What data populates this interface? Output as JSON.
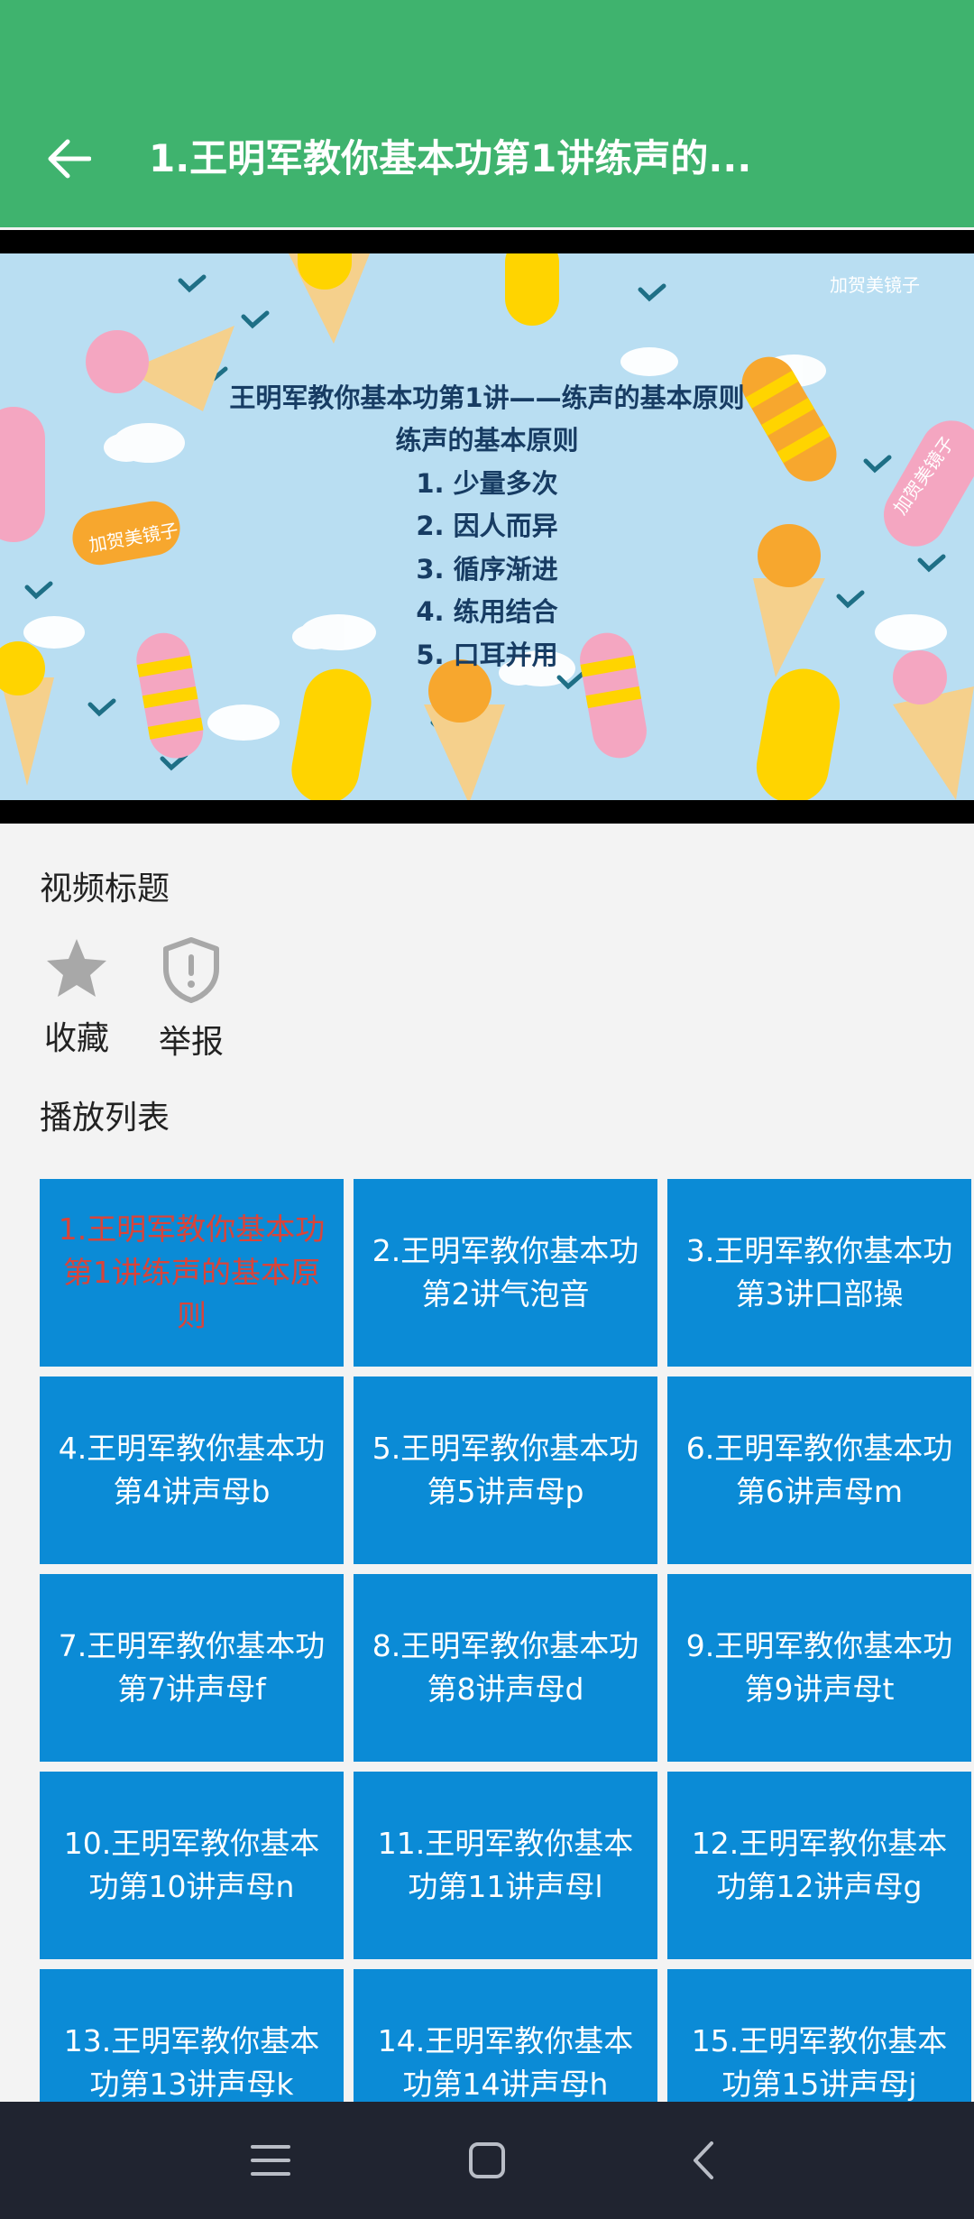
{
  "header": {
    "title": "1.王明军教你基本功第1讲练声的...",
    "back_icon": "arrow-left-icon"
  },
  "video": {
    "watermark": "加贺美镜子",
    "slide_title": "王明军教你基本功第1讲——练声的基本原则",
    "slide_subtitle": "练声的基本原则",
    "slide_points": [
      "1. 少量多次",
      "2. 因人而异",
      "3. 循序渐进",
      "4. 练用结合",
      "5. 口耳并用"
    ],
    "sticker_left": "加贺美镜子",
    "sticker_right": "加贺美镜子"
  },
  "details": {
    "video_title_label": "视频标题",
    "favorite_label": "收藏",
    "report_label": "举报",
    "playlist_label": "播放列表"
  },
  "playlist": [
    {
      "label": "1.王明军教你基本功第1讲练声的基本原则",
      "active": true
    },
    {
      "label": "2.王明军教你基本功第2讲气泡音"
    },
    {
      "label": "3.王明军教你基本功第3讲口部操"
    },
    {
      "label": "4.王明军教你基本功第4讲声母b"
    },
    {
      "label": "5.王明军教你基本功第5讲声母p"
    },
    {
      "label": "6.王明军教你基本功第6讲声母m"
    },
    {
      "label": "7.王明军教你基本功第7讲声母f"
    },
    {
      "label": "8.王明军教你基本功第8讲声母d"
    },
    {
      "label": "9.王明军教你基本功第9讲声母t"
    },
    {
      "label": "10.王明军教你基本功第10讲声母n"
    },
    {
      "label": "11.王明军教你基本功第11讲声母l"
    },
    {
      "label": "12.王明军教你基本功第12讲声母g"
    },
    {
      "label": "13.王明军教你基本功第13讲声母k"
    },
    {
      "label": "14.王明军教你基本功第14讲声母h"
    },
    {
      "label": "15.王明军教你基本功第15讲声母j"
    }
  ],
  "colors": {
    "appbar": "#3fb36e",
    "tile": "#0b8bd6",
    "active_text": "#d9443a",
    "navbar": "#202430"
  },
  "navbar": {
    "icons": [
      "menu-icon",
      "home-square-icon",
      "back-chevron-icon"
    ]
  }
}
